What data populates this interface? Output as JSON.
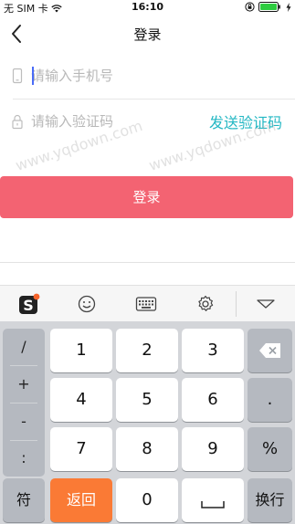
{
  "status_bar": {
    "carrier": "无 SIM 卡",
    "time": "16:10"
  },
  "nav": {
    "title": "登录"
  },
  "form": {
    "phone_placeholder": "请输入手机号",
    "code_placeholder": "请输入验证码",
    "send_code_label": "发送验证码",
    "login_label": "登录"
  },
  "watermark": {
    "text_1": "www.yqdown.com",
    "text_2": "www.yqdown.com"
  },
  "keyboard": {
    "left_column": [
      "/",
      "+",
      "-",
      ":"
    ],
    "rows": [
      [
        "1",
        "2",
        "3"
      ],
      [
        "4",
        "5",
        "6"
      ],
      [
        "7",
        "8",
        "9"
      ]
    ],
    "dot_label": ".",
    "percent_label": "%",
    "symbol_label": "符",
    "return_label": "返回",
    "zero_label": "0",
    "newline_label": "换行"
  },
  "colors": {
    "accent_login": "#f36372",
    "send_code": "#23b7c3",
    "return_key": "#fa7a35"
  }
}
